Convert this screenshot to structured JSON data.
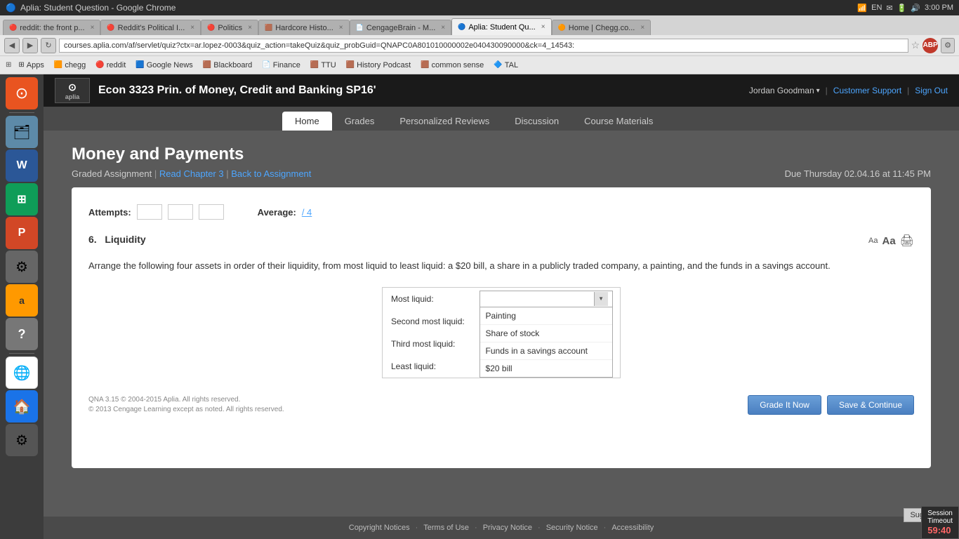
{
  "window": {
    "title": "Aplia: Student Question - Google Chrome"
  },
  "system_tray": {
    "wifi_icon": "📶",
    "keyboard_label": "EN",
    "time": "3:00 PM",
    "battery": "🔋",
    "sound": "🔊"
  },
  "tabs": [
    {
      "id": "tab1",
      "favicon": "🔴",
      "label": "reddit: the front p...",
      "active": false
    },
    {
      "id": "tab2",
      "favicon": "🔴",
      "label": "Reddit's Political...",
      "active": false
    },
    {
      "id": "tab3",
      "favicon": "🔴",
      "label": "Politics",
      "active": false
    },
    {
      "id": "tab4",
      "favicon": "🟫",
      "label": "Hardcore Histo...",
      "active": false
    },
    {
      "id": "tab5",
      "favicon": "📄",
      "label": "CengageBrain - M...",
      "active": false
    },
    {
      "id": "tab6",
      "favicon": "🔵",
      "label": "Aplia: Student Qu...",
      "active": true
    },
    {
      "id": "tab7",
      "favicon": "🟠",
      "label": "Home | Chegg.co...",
      "active": false
    }
  ],
  "nav": {
    "address": "courses.aplia.com/af/servlet/quiz?ctx=ar.lopez-0003&quiz_action=takeQuiz&quiz_probGuid=QNAPC0A801010000002e040430090000&ck=4_14543:"
  },
  "bookmarks": [
    {
      "label": "Apps",
      "icon": "⊞"
    },
    {
      "label": "chegg",
      "icon": "🟧"
    },
    {
      "label": "reddit",
      "icon": "🔴"
    },
    {
      "label": "Google News",
      "icon": "🟦"
    },
    {
      "label": "Blackboard",
      "icon": "🟫"
    },
    {
      "label": "Finance",
      "icon": "📄"
    },
    {
      "label": "TTU",
      "icon": "🟫"
    },
    {
      "label": "History Podcast",
      "icon": "🟫"
    },
    {
      "label": "common sense",
      "icon": "🟫"
    },
    {
      "label": "TAL",
      "icon": "🔷"
    }
  ],
  "aplia": {
    "logo_text": "aplia",
    "course_title": "Econ 3323 Prin. of Money, Credit and Banking SP16'",
    "user": "Jordan Goodman",
    "customer_support": "Customer Support",
    "sign_out": "Sign Out",
    "nav_tabs": [
      {
        "label": "Home",
        "active": false
      },
      {
        "label": "Grades",
        "active": false
      },
      {
        "label": "Personalized Reviews",
        "active": false
      },
      {
        "label": "Discussion",
        "active": false
      },
      {
        "label": "Course Materials",
        "active": false
      }
    ]
  },
  "assignment": {
    "title": "Money and Payments",
    "type": "Graded Assignment",
    "read_chapter": "Read Chapter 3",
    "back_to_assignment": "Back to Assignment",
    "due_label": "Due Thursday",
    "due_date": "02.04.16 at 11:45 PM"
  },
  "quiz": {
    "attempts_label": "Attempts:",
    "attempt_boxes": [
      "",
      "",
      ""
    ],
    "average_label": "Average:",
    "average_value": "/ 4",
    "question_number": "6.",
    "question_topic": "Liquidity",
    "question_text": "Arrange the following four assets in order of their liquidity, from most liquid to least liquid: a $20 bill, a share in a publicly traded company, a painting, and the funds in a savings account.",
    "font_small": "Aa",
    "font_large": "Aa",
    "rows": [
      {
        "label": "Most liquid:",
        "control_type": "dropdown_open"
      },
      {
        "label": "Second most liquid:",
        "control_type": "empty"
      },
      {
        "label": "Third most liquid:",
        "control_type": "empty"
      },
      {
        "label": "Least liquid:",
        "control_type": "empty"
      }
    ],
    "dropdown_options": [
      "Painting",
      "Share of stock",
      "Funds in a savings account",
      "$20 bill"
    ],
    "footer_text_line1": "QNA 3.15 © 2004-2015 Aplia. All rights reserved.",
    "footer_text_line2": "© 2013 Cengage Learning except as noted. All rights reserved.",
    "btn_grade": "Grade It Now",
    "btn_save": "Save & Continue"
  },
  "page_footer": {
    "links": [
      "Copyright Notices",
      "Terms of Use",
      "Privacy Notice",
      "Security Notice",
      "Accessibility"
    ]
  },
  "session": {
    "suggestions_label": "Suggestions",
    "timeout_label": "Session\nTimeout",
    "timer": "59:40"
  }
}
